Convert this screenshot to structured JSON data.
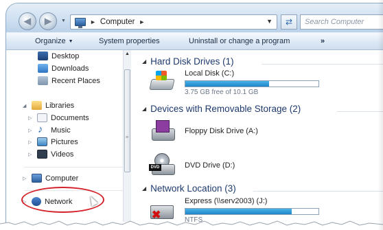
{
  "address_bar": {
    "crumb_separator": "►",
    "location": "Computer",
    "trailing_separator": "►"
  },
  "search": {
    "placeholder": "Search Computer"
  },
  "command_bar": {
    "organize": "Organize",
    "system_properties": "System properties",
    "uninstall": "Uninstall or change a program",
    "more": "»"
  },
  "nav_pane": {
    "favorites": [
      {
        "label": "Desktop",
        "icon": "desktop-icon"
      },
      {
        "label": "Downloads",
        "icon": "downloads-icon"
      },
      {
        "label": "Recent Places",
        "icon": "recent-places-icon"
      }
    ],
    "libraries": {
      "label": "Libraries",
      "items": [
        {
          "label": "Documents",
          "icon": "documents-icon"
        },
        {
          "label": "Music",
          "icon": "music-icon"
        },
        {
          "label": "Pictures",
          "icon": "pictures-icon"
        },
        {
          "label": "Videos",
          "icon": "videos-icon"
        }
      ]
    },
    "computer": "Computer",
    "network": "Network"
  },
  "content": {
    "groups": {
      "hard_disk": "Hard Disk Drives (1)",
      "removable": "Devices with Removable Storage (2)",
      "network": "Network Location (3)"
    },
    "drives": {
      "local_disk": {
        "name": "Local Disk (C:)",
        "free_text": "3.75 GB free of 10.1 GB",
        "used_fraction": 0.63
      },
      "floppy": {
        "name": "Floppy Disk Drive (A:)"
      },
      "dvd": {
        "name": "DVD Drive (D:)",
        "badge": "DVD"
      },
      "express": {
        "name": "Express (\\\\serv2003) (J:)",
        "used_fraction": 0.8,
        "fs": "NTFS"
      }
    }
  },
  "colors": {
    "group_header": "#1e3a6d",
    "annotation": "#d4232b",
    "usage_bar": "#1e86c8"
  }
}
